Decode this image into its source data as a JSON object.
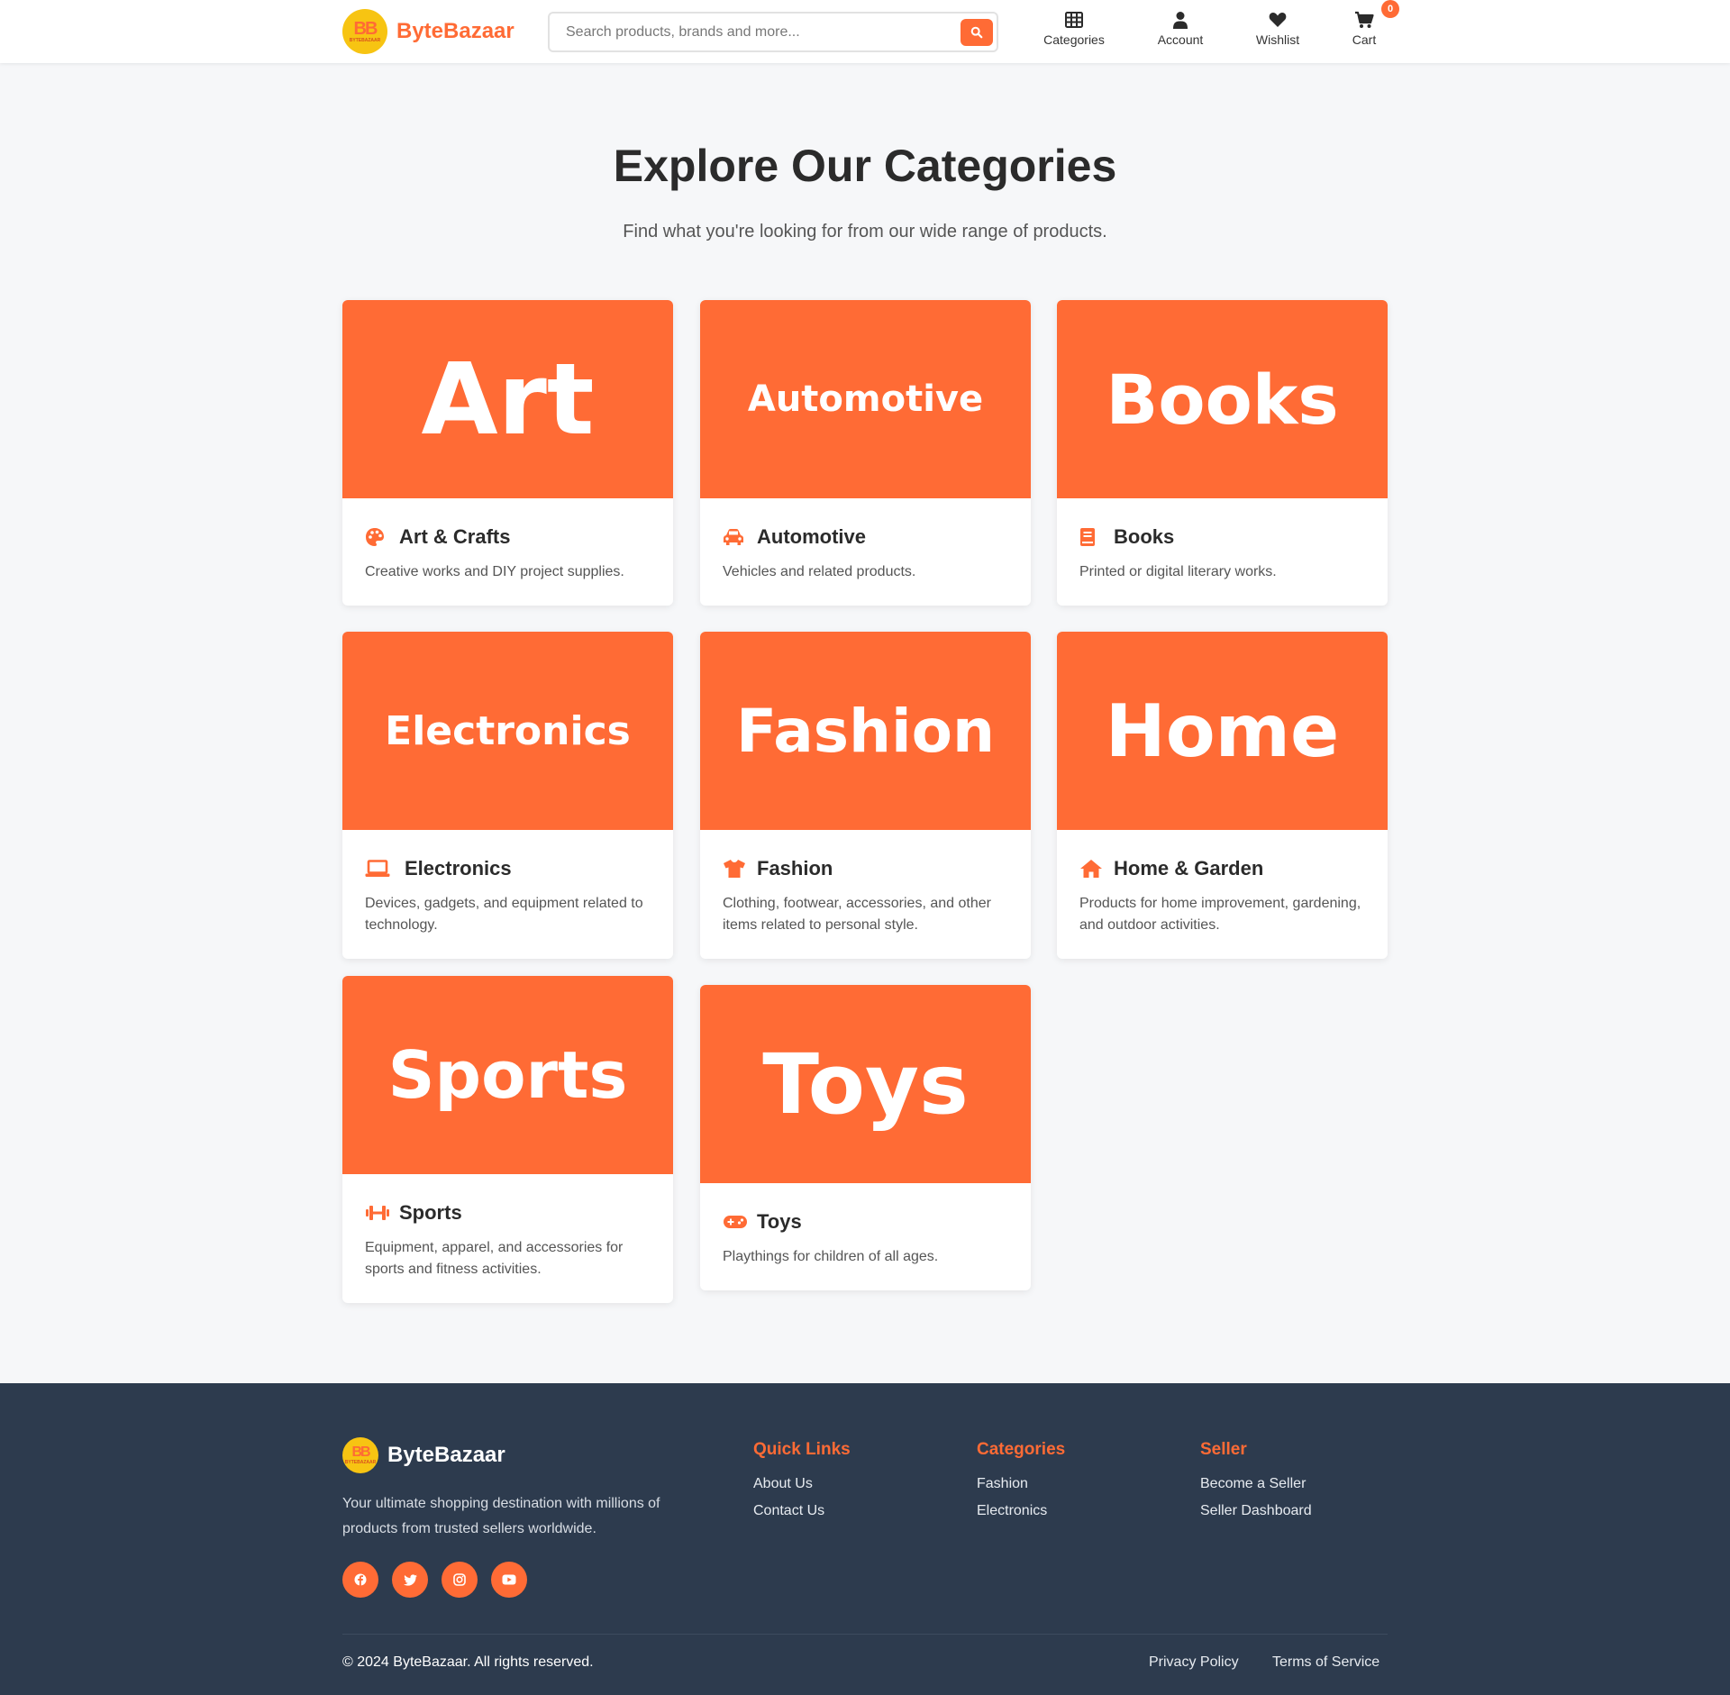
{
  "brand": {
    "name": "ByteBazaar",
    "logo_mark": "BB",
    "logo_small": "BYTEBAZAAR",
    "accent_color": "#ff6b35",
    "badge_color": "#f7c412"
  },
  "header": {
    "search_placeholder": "Search products, brands and more...",
    "nav": [
      {
        "label": "Categories",
        "icon": "grid-icon"
      },
      {
        "label": "Account",
        "icon": "user-icon"
      },
      {
        "label": "Wishlist",
        "icon": "heart-icon"
      },
      {
        "label": "Cart",
        "icon": "cart-icon"
      }
    ],
    "cart_count": "0"
  },
  "hero": {
    "title": "Explore Our Categories",
    "subtitle": "Find what you're looking for from our wide range of products."
  },
  "categories": [
    {
      "banner": "Art",
      "title": "Art & Crafts",
      "desc": "Creative works and DIY project supplies.",
      "icon": "palette-icon"
    },
    {
      "banner": "Automotive",
      "title": "Automotive",
      "desc": "Vehicles and related products.",
      "icon": "car-icon"
    },
    {
      "banner": "Books",
      "title": "Books",
      "desc": "Printed or digital literary works.",
      "icon": "book-icon"
    },
    {
      "banner": "Electronics",
      "title": "Electronics",
      "desc": "Devices, gadgets, and equipment related to technology.",
      "icon": "laptop-icon"
    },
    {
      "banner": "Fashion",
      "title": "Fashion",
      "desc": "Clothing, footwear, accessories, and other items related to personal style.",
      "icon": "shirt-icon"
    },
    {
      "banner": "Home",
      "title": "Home & Garden",
      "desc": "Products for home improvement, gardening, and outdoor activities.",
      "icon": "home-icon"
    },
    {
      "banner": "Sports",
      "title": "Sports",
      "desc": "Equipment, apparel, and accessories for sports and fitness activities.",
      "icon": "dumbbell-icon"
    },
    {
      "banner": "Toys",
      "title": "Toys",
      "desc": "Playthings for children of all ages.",
      "icon": "gamepad-icon"
    }
  ],
  "footer": {
    "about": "Your ultimate shopping destination with millions of products from trusted sellers worldwide.",
    "socials": [
      "facebook-icon",
      "twitter-icon",
      "instagram-icon",
      "youtube-icon"
    ],
    "columns": [
      {
        "heading": "Quick Links",
        "links": [
          "About Us",
          "Contact Us"
        ]
      },
      {
        "heading": "Categories",
        "links": [
          "Fashion",
          "Electronics"
        ]
      },
      {
        "heading": "Seller",
        "links": [
          "Become a Seller",
          "Seller Dashboard"
        ]
      }
    ],
    "copyright": "© 2024 ByteBazaar. All rights reserved.",
    "legal": [
      "Privacy Policy",
      "Terms of Service"
    ]
  }
}
